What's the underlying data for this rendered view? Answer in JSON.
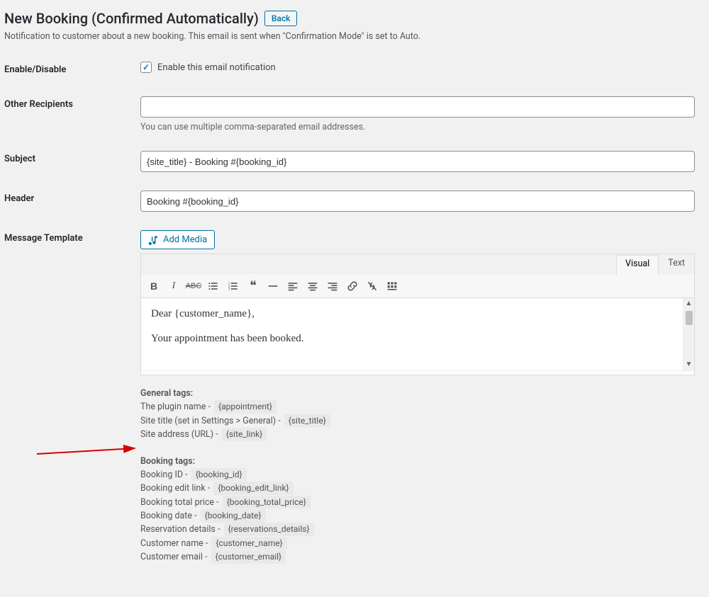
{
  "page": {
    "title": "New Booking (Confirmed Automatically)",
    "back_label": "Back",
    "subtitle": "Notification to customer about a new booking. This email is sent when \"Confirmation Mode\" is set to Auto."
  },
  "fields": {
    "enable": {
      "label": "Enable/Disable",
      "checkbox_label": "Enable this email notification",
      "checked": true
    },
    "recipients": {
      "label": "Other Recipients",
      "value": "",
      "help": "You can use multiple comma-separated email addresses."
    },
    "subject": {
      "label": "Subject",
      "value": "{site_title} - Booking #{booking_id}"
    },
    "header": {
      "label": "Header",
      "value": "Booking #{booking_id}"
    },
    "template": {
      "label": "Message Template",
      "add_media_label": "Add Media",
      "tab_visual": "Visual",
      "tab_text": "Text",
      "body_line1": "Dear {customer_name},",
      "body_line2": "Your appointment has been booked."
    }
  },
  "tags": {
    "general_title": "General tags:",
    "general": [
      {
        "label": "The plugin name - ",
        "code": "{appointment}"
      },
      {
        "label": "Site title (set in Settings > General) - ",
        "code": "{site_title}"
      },
      {
        "label": "Site address (URL) - ",
        "code": "{site_link}"
      }
    ],
    "booking_title": "Booking tags:",
    "booking": [
      {
        "label": "Booking ID - ",
        "code": "{booking_id}"
      },
      {
        "label": "Booking edit link - ",
        "code": "{booking_edit_link}"
      },
      {
        "label": "Booking total price - ",
        "code": "{booking_total_price}"
      },
      {
        "label": "Booking date - ",
        "code": "{booking_date}"
      },
      {
        "label": "Reservation details - ",
        "code": "{reservations_details}"
      },
      {
        "label": "Customer name - ",
        "code": "{customer_name}"
      },
      {
        "label": "Customer email - ",
        "code": "{customer_email}"
      }
    ]
  }
}
